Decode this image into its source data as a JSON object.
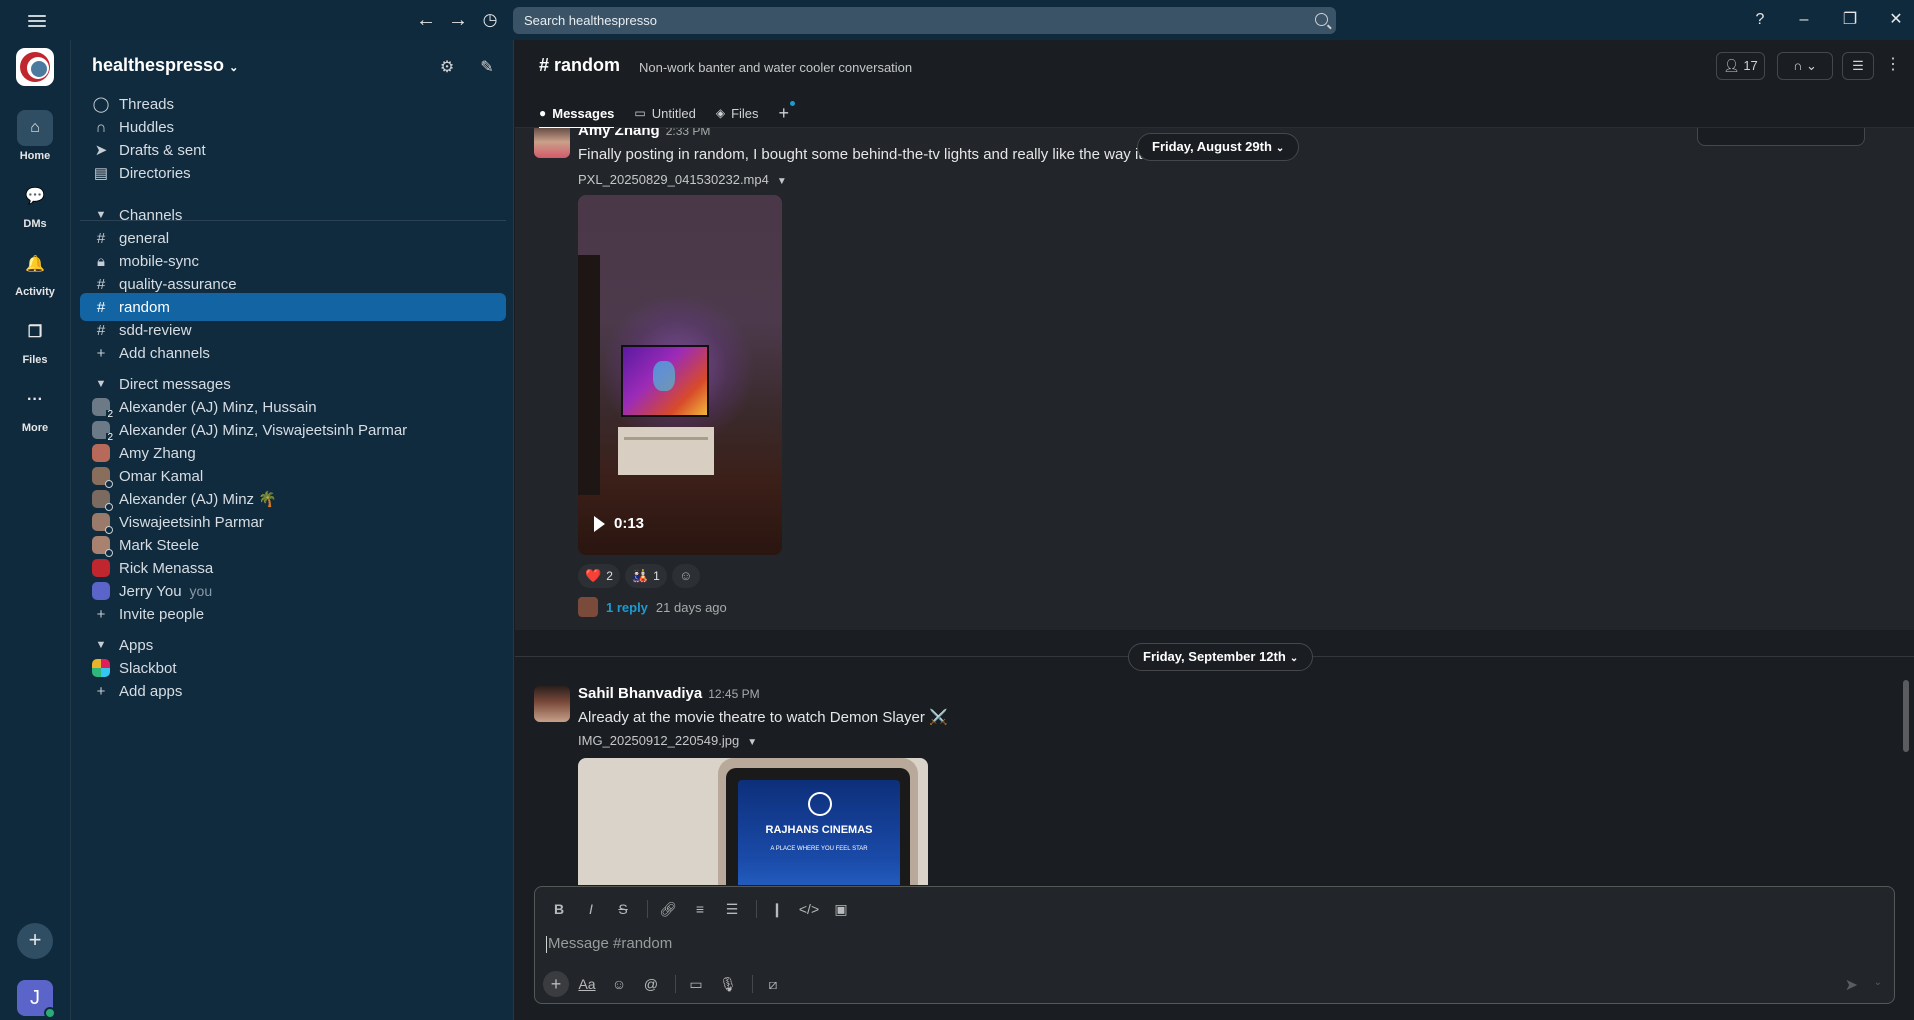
{
  "topbar": {
    "search_placeholder": "Search healthespresso",
    "back_icon": "arrow-left-icon",
    "forward_icon": "arrow-right-icon",
    "history_icon": "clock-icon"
  },
  "rail": {
    "home": "Home",
    "dms": "DMs",
    "activity": "Activity",
    "files": "Files",
    "more": "More",
    "user_initial": "J"
  },
  "sidebar": {
    "workspace": "healthespresso",
    "nav": [
      "Threads",
      "Huddles",
      "Drafts & sent",
      "Directories"
    ],
    "channels_header": "Channels",
    "channels": [
      "general",
      "mobile-sync",
      "quality-assurance",
      "random",
      "sdd-review"
    ],
    "add_channels": "Add channels",
    "dm_header": "Direct messages",
    "dms": [
      {
        "name": "Alexander (AJ) Minz, Hussain",
        "count": "2"
      },
      {
        "name": "Alexander (AJ) Minz, Viswajeetsinh Parmar",
        "count": "2"
      },
      {
        "name": "Amy Zhang"
      },
      {
        "name": "Omar Kamal"
      },
      {
        "name": "Alexander (AJ) Minz 🌴"
      },
      {
        "name": "Viswajeetsinh Parmar"
      },
      {
        "name": "Mark Steele"
      },
      {
        "name": "Rick Menassa"
      },
      {
        "name": "Jerry You",
        "you": "you"
      }
    ],
    "invite": "Invite people",
    "apps_header": "Apps",
    "apps": [
      "Slackbot"
    ],
    "add_apps": "Add apps"
  },
  "channel": {
    "name": "# random",
    "description": "Non-work banter and water cooler conversation",
    "member_count": "17",
    "tabs": [
      "Messages",
      "Untitled",
      "Files"
    ]
  },
  "messages": [
    {
      "sender": "Amy Zhang",
      "time": "2:33 PM",
      "text": "Finally posting in random, I bought some behind-the-tv lights and really like the way it",
      "file": "PXL_20250829_041530232.mp4",
      "video_duration": "0:13",
      "reactions": [
        {
          "emoji": "❤️",
          "count": "2"
        },
        {
          "emoji": "🎎",
          "count": "1"
        }
      ],
      "reply_label": "1 reply",
      "reply_ago": "21 days ago"
    },
    {
      "sender": "Sahil Bhanvadiya",
      "time": "12:45 PM",
      "text": "Already at the movie theatre to watch Demon Slayer ⚔️",
      "file": "IMG_20250912_220549.jpg",
      "photo_text_main": "RAJHANS CINEMAS",
      "photo_text_small": "A PLACE WHERE YOU FEEL STAR"
    }
  ],
  "date_dividers": [
    "Friday, August 29th",
    "Friday, September 12th"
  ],
  "composer": {
    "placeholder": "Message #random"
  },
  "colors": {
    "active_item": "#1264a3",
    "sidebar_bg": "#112b3e",
    "link": "#1d9bd1"
  }
}
